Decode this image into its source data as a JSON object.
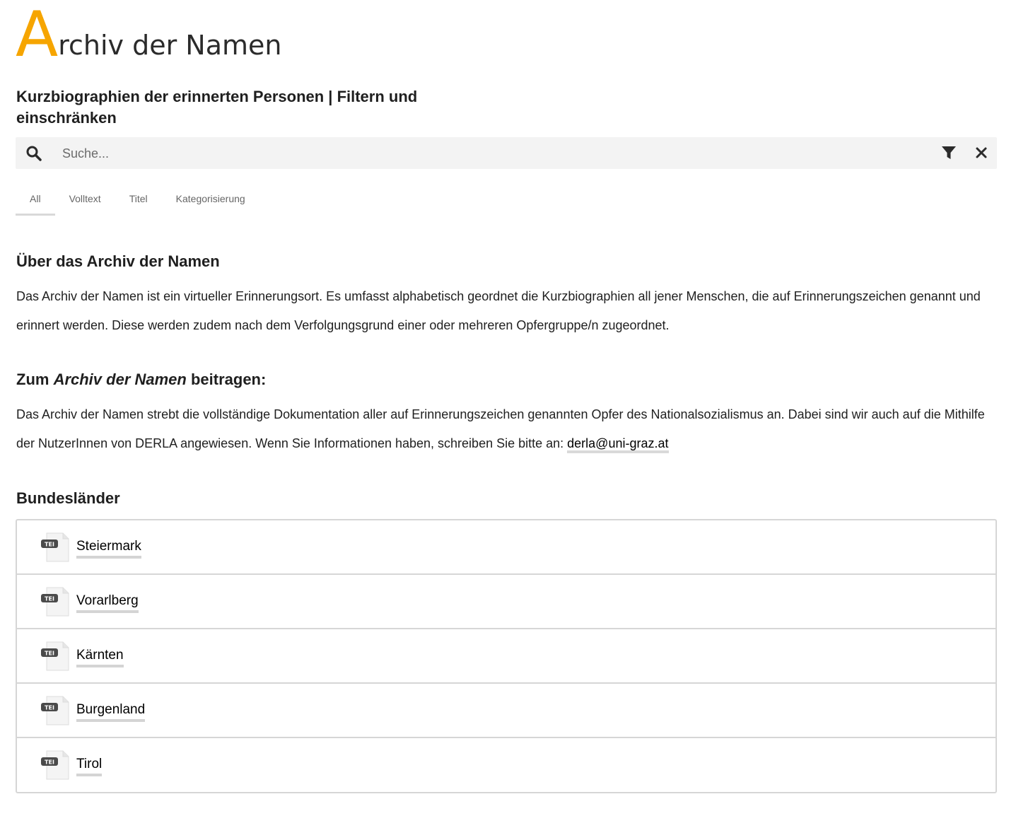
{
  "header": {
    "title_initial": "A",
    "title_rest": "rchiv der Namen",
    "subtitle": "Kurzbiographien der erinnerten Personen | Filtern und einschränken"
  },
  "search": {
    "placeholder": "Suche...",
    "value": ""
  },
  "tabs": [
    {
      "label": "All",
      "active": true
    },
    {
      "label": "Volltext",
      "active": false
    },
    {
      "label": "Titel",
      "active": false
    },
    {
      "label": "Kategorisierung",
      "active": false
    }
  ],
  "about": {
    "heading": "Über das Archiv der Namen",
    "text": "Das Archiv der Namen ist ein virtueller Erinnerungsort. Es umfasst alphabetisch geordnet die Kurzbiographien all jener Menschen, die auf Erinnerungszeichen genannt und erinnert werden. Diese werden zudem nach dem Verfolgungsgrund einer oder mehreren Opfergruppe/n zugeordnet."
  },
  "contribute": {
    "heading_prefix": "Zum ",
    "heading_em": "Archiv der Namen",
    "heading_suffix": " beitragen:",
    "text": "Das Archiv der Namen strebt die vollständige Dokumentation aller auf Erinnerungszeichen genannten Opfer des Nationalsozialismus an. Dabei sind wir auch auf die Mithilfe der NutzerInnen von DERLA angewiesen. Wenn Sie Informationen haben, schreiben Sie bitte an: ",
    "email": "derla@uni-graz.at"
  },
  "states": {
    "heading": "Bundesländer",
    "icon_label": "TEI",
    "items": [
      {
        "label": "Steiermark"
      },
      {
        "label": "Vorarlberg"
      },
      {
        "label": "Kärnten"
      },
      {
        "label": "Burgenland"
      },
      {
        "label": "Tirol"
      }
    ]
  },
  "colors": {
    "accent": "#f6a500",
    "search_bg": "#f3f3f3",
    "border": "#d6d6d6"
  },
  "icons": {
    "search": "search-icon",
    "filter": "filter-icon",
    "close": "close-icon",
    "file": "tei-file-icon"
  }
}
